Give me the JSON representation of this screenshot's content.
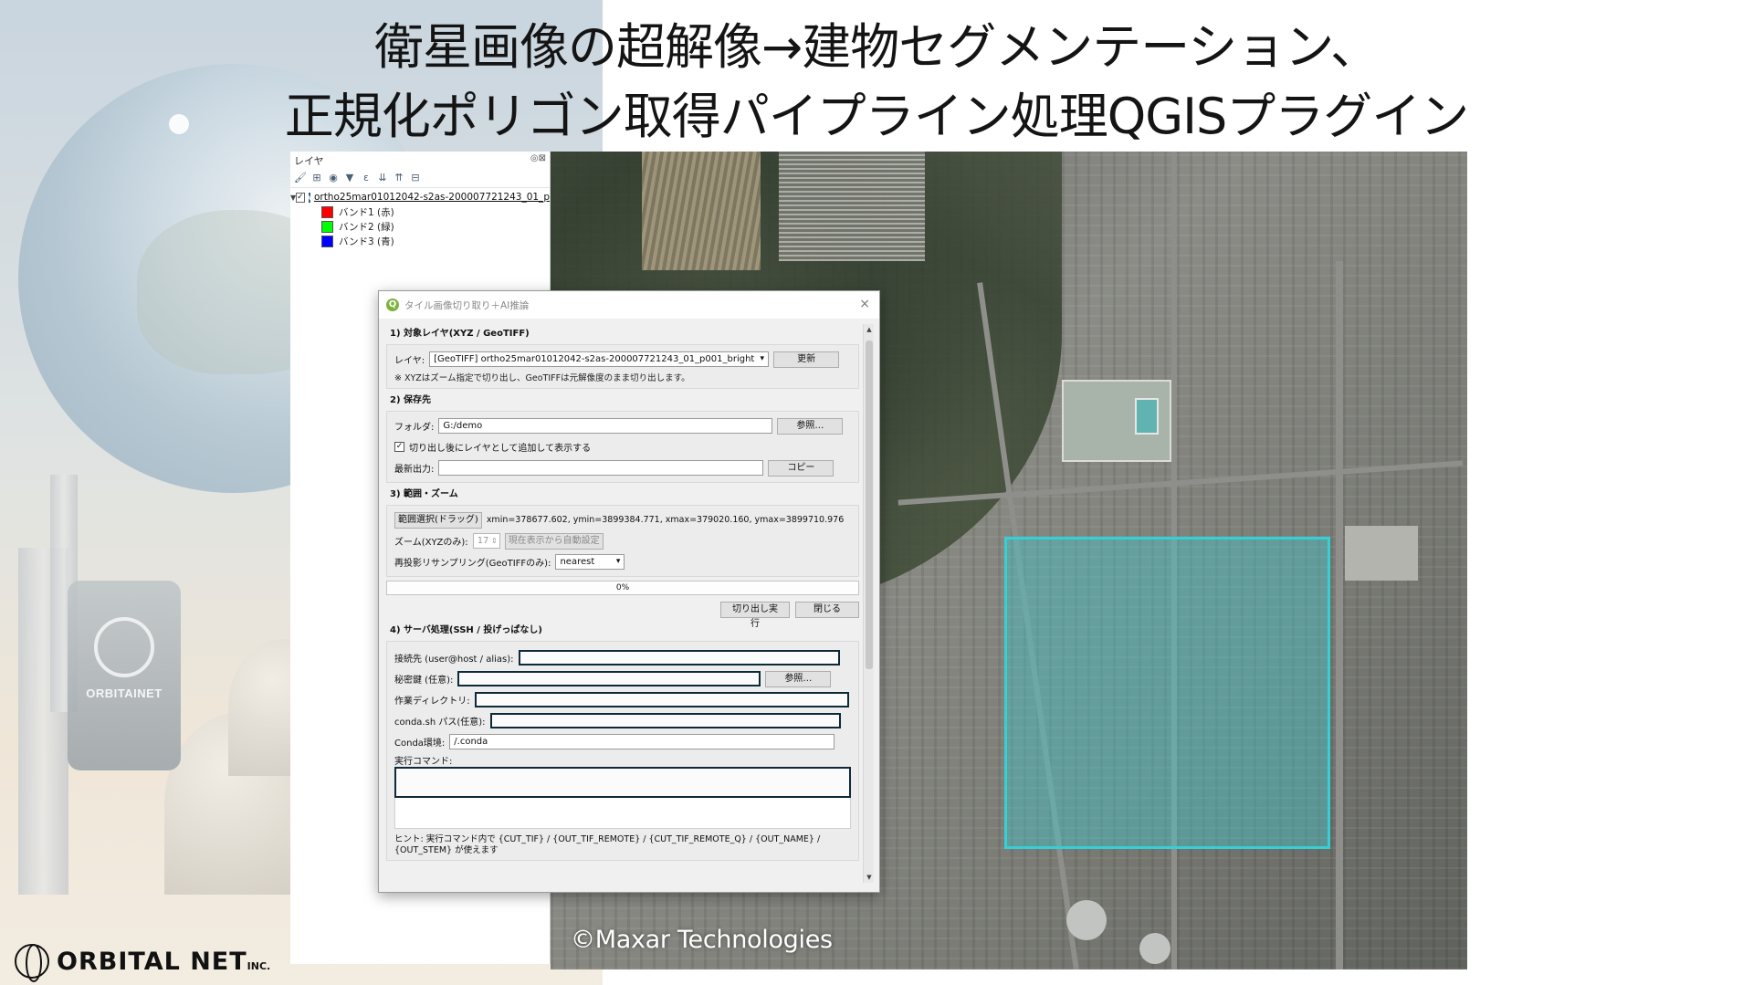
{
  "slide": {
    "title_line1": "衛星画像の超解像→建物セグメンテーション、",
    "title_line2": "正規化ポリゴン取得パイプライン処理QGISプラグイン",
    "copyright": "©Maxar Technologies",
    "brand_tile_text": "ORBITAINET",
    "footer_logo": "ORBITAL NET",
    "footer_logo_suffix": "INC."
  },
  "layer_panel": {
    "title": "レイヤ",
    "header_buttons": "◎⊠",
    "toolbar_icons": [
      "paint-brush-icon",
      "add-group-icon",
      "eye-icon",
      "filter-icon",
      "filter-expression-icon",
      "expand-all-icon",
      "collapse-all-icon",
      "remove-layer-icon"
    ],
    "layer": {
      "name": "ortho25mar01012042-s2as-200007721243_01_p",
      "checked": true
    },
    "bands": [
      {
        "label": "バンド1 (赤)",
        "color": "#ff0000"
      },
      {
        "label": "バンド2 (緑)",
        "color": "#00ff00"
      },
      {
        "label": "バンド3 (青)",
        "color": "#0000ff"
      }
    ]
  },
  "dialog": {
    "title": "タイル画像切り取り＋AI推論",
    "close_symbol": "×",
    "section1": {
      "title": "1) 対象レイヤ(XYZ / GeoTIFF)",
      "layer_label": "レイヤ:",
      "layer_value": "[GeoTIFF] ortho25mar01012042-s2as-200007721243_01_p001_bright",
      "refresh_button": "更新",
      "note": "※ XYZはズーム指定で切り出し、GeoTIFFは元解像度のまま切り出します。"
    },
    "section2": {
      "title": "2) 保存先",
      "folder_label": "フォルダ:",
      "folder_value": "G:/demo",
      "browse_button": "参照…",
      "add_layer_checked": true,
      "add_layer_label": "切り出し後にレイヤとして追加して表示する",
      "latest_label": "最新出力:",
      "latest_value": "",
      "copy_button": "コピー"
    },
    "section3": {
      "title": "3) 範囲・ズーム",
      "range_button": "範囲選択(ドラッグ)",
      "coords": "xmin=378677.602, ymin=3899384.771, xmax=379020.160, ymax=3899710.976",
      "zoom_label": "ズーム(XYZのみ):",
      "zoom_value": "17",
      "auto_button": "現在表示から自動設定",
      "resample_label": "再投影リサンプリング(GeoTIFFのみ):",
      "resample_value": "nearest",
      "progress_text": "0%",
      "progress_value": 0,
      "run_button": "切り出し実行",
      "close_button": "閉じる"
    },
    "section4": {
      "title": "4) サーバ処理(SSH / 投げっぱなし)",
      "host_label": "接続先 (user@host / alias):",
      "host_value": "",
      "key_label": "秘密鍵 (任意):",
      "key_value": "",
      "key_browse_button": "参照…",
      "workdir_label": "作業ディレクトリ:",
      "workdir_value": "",
      "condash_label": "conda.sh パス(任意):",
      "condash_value": "",
      "condaenv_label": "Conda環境:",
      "condaenv_value": "/.conda",
      "command_label": "実行コマンド:",
      "command_value": "",
      "hint_line1": "ヒント: 実行コマンド内で {CUT_TIF} / {OUT_TIF_REMOTE} / {CUT_TIF_REMOTE_Q} / {OUT_NAME} /",
      "hint_line2": "{OUT_STEM} が使えます"
    }
  },
  "colors": {
    "selection_fill": "rgba(64,200,205,0.42)",
    "selection_border": "#33d0d6",
    "titlebar": "#ffffff",
    "dialog_bg": "#f0f0f0"
  }
}
